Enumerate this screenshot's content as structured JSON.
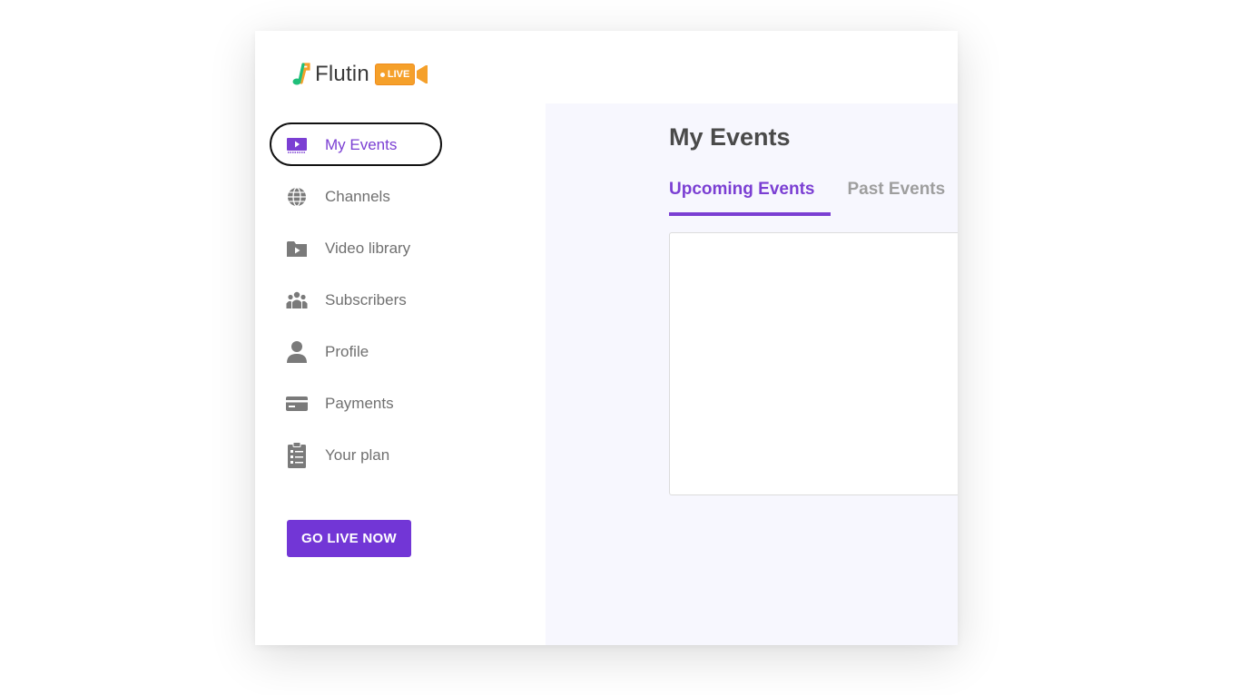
{
  "app": {
    "name": "Flutin",
    "badge": "LIVE"
  },
  "colors": {
    "accent": "#7b3fd3",
    "button": "#7236d6",
    "badge": "#f5a02a",
    "main_bg": "#f7f7fe"
  },
  "sidebar": {
    "items": [
      {
        "label": "My Events",
        "icon": "video-presentation-icon",
        "active": true
      },
      {
        "label": "Channels",
        "icon": "globe-icon",
        "active": false
      },
      {
        "label": "Video library",
        "icon": "video-folder-icon",
        "active": false
      },
      {
        "label": "Subscribers",
        "icon": "users-group-icon",
        "active": false
      },
      {
        "label": "Profile",
        "icon": "user-icon",
        "active": false
      },
      {
        "label": "Payments",
        "icon": "credit-card-icon",
        "active": false
      },
      {
        "label": "Your plan",
        "icon": "clipboard-list-icon",
        "active": false
      }
    ],
    "go_live_label": "GO LIVE NOW"
  },
  "main": {
    "title": "My Events",
    "tabs": [
      {
        "label": "Upcoming Events",
        "active": true
      },
      {
        "label": "Past Events",
        "active": false
      }
    ]
  }
}
